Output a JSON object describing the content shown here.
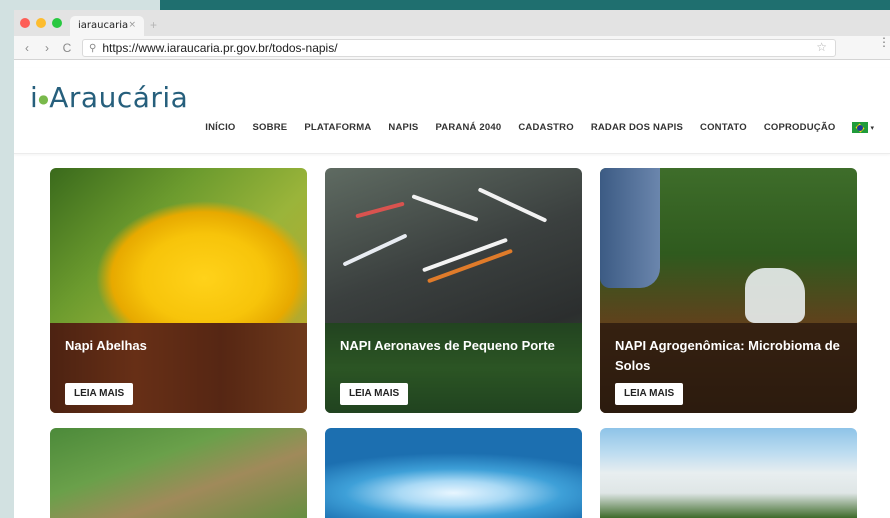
{
  "browser": {
    "tab_title": "iaraucaria",
    "tab_close": "×",
    "new_tab": "+",
    "url": "https://www.iaraucaria.pr.gov.br/todos-napis/",
    "back": "‹",
    "forward": "›",
    "reload": "C",
    "lock_glyph": "🔍",
    "star_glyph": "☆",
    "menu_glyph": "⋮"
  },
  "site": {
    "logo_text_pre": "i",
    "logo_text_main": "Araucária",
    "nav": [
      "INÍCIO",
      "SOBRE",
      "PLATAFORMA",
      "NAPIS",
      "PARANÁ 2040",
      "CADASTRO",
      "RADAR DOS NAPIS",
      "CONTATO",
      "COPRODUÇÃO"
    ],
    "language": {
      "flag": "brazil-flag-icon",
      "caret": "▾"
    }
  },
  "cards": [
    {
      "title": "Napi Abelhas",
      "button": "LEIA MAIS",
      "image": "bee-on-yellow-flower"
    },
    {
      "title": "NAPI Aeronaves de Pequeno Porte",
      "button": "LEIA MAIS",
      "image": "small-aircraft-on-tarmac"
    },
    {
      "title": "NAPI Agrogenômica: Microbioma de Solos",
      "button": "LEIA MAIS",
      "image": "soil-sampling-in-field"
    },
    {
      "title": "",
      "button": "",
      "image": "aerial-farm-plots"
    },
    {
      "title": "",
      "button": "",
      "image": "water-splash"
    },
    {
      "title": "",
      "button": "",
      "image": "greenhouse-tunnel"
    }
  ],
  "colors": {
    "logo": "#265f7c",
    "logo_accent": "#79b94b",
    "teal_band": "#1f6f6f"
  }
}
